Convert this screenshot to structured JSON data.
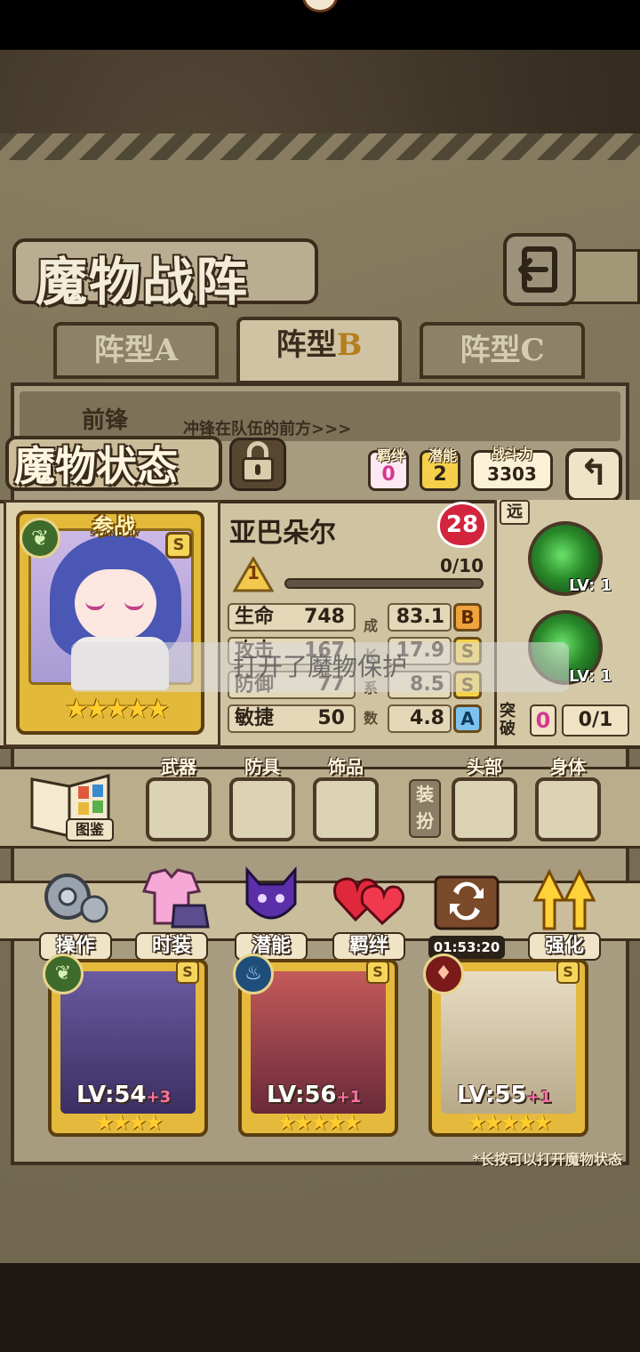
{
  "screen_title": "魔物战阵",
  "tabs": [
    {
      "prefix": "阵型",
      "suffix": "A",
      "active": false
    },
    {
      "prefix": "阵型",
      "suffix": "B",
      "active": true
    },
    {
      "prefix": "阵型",
      "suffix": "C",
      "active": false
    }
  ],
  "lane": {
    "label": "前锋",
    "desc": "冲锋在队伍的前方>>>"
  },
  "status": {
    "title": "魔物状态",
    "bond": {
      "label": "羁绊",
      "value": "0"
    },
    "potential": {
      "label": "潜能",
      "value": "2"
    },
    "power": {
      "label": "战斗力",
      "value": "3303"
    }
  },
  "monster": {
    "name": "亚巴朵尔",
    "level": "28",
    "rank": "1",
    "exp": "0/10",
    "exp_progress": 0,
    "standby": "参战",
    "standby_sub": "STAND BY",
    "grade_badge": "S",
    "star_count": 5,
    "stars": "★★★★★",
    "attrs": [
      {
        "name": "生命",
        "value": "748",
        "growth": "83.1",
        "grade": "B"
      },
      {
        "name": "攻击",
        "value": "167",
        "growth": "17.9",
        "grade": "S"
      },
      {
        "name": "防御",
        "value": "77",
        "growth": "8.5",
        "grade": "S"
      },
      {
        "name": "敏捷",
        "value": "50",
        "growth": "4.8",
        "grade": "A"
      }
    ],
    "growth_labels": [
      "成",
      "长",
      "系",
      "数"
    ]
  },
  "skills": {
    "range_tag": "远",
    "items": [
      {
        "lv": "LV: 1"
      },
      {
        "lv": "LV: 1"
      }
    ],
    "break_label": "突破",
    "break_value": "0",
    "break_progress": "0/1"
  },
  "toast": "打开了魔物保护",
  "equipment": {
    "book_label": "图鉴",
    "slots": [
      "武器",
      "防具",
      "饰品",
      "头部",
      "身体"
    ],
    "dressup": "装扮"
  },
  "actions": [
    {
      "label": "操作",
      "icon": "gear-icon"
    },
    {
      "label": "时装",
      "icon": "outfit-icon"
    },
    {
      "label": "潜能",
      "icon": "demon-icon"
    },
    {
      "label": "羁绊",
      "icon": "hearts-icon"
    },
    {
      "timer": "01:53:20",
      "icon": "swap-chest-icon"
    },
    {
      "label": "强化",
      "icon": "upgrade-arrows-icon"
    }
  ],
  "team": [
    {
      "lv": "LV:54",
      "plus": "+3",
      "element": "leaf",
      "stars": "★★★★",
      "rank": "S"
    },
    {
      "lv": "LV:56",
      "plus": "+1",
      "element": "water",
      "stars": "★★★★★",
      "rank": "S"
    },
    {
      "lv": "LV:55",
      "plus": "+1",
      "element": "fire",
      "stars": "★★★★★",
      "rank": "S"
    }
  ],
  "hint": "*长按可以打开魔物状态",
  "colors": {
    "accent_gold": "#e3b93a",
    "level_heart": "#d2253d",
    "grade_S": "#f3d24a",
    "grade_A": "#7ec3f0",
    "grade_B": "#f0a33c",
    "potential_chip": "#f6d04a",
    "bond_chip": "#f7a8d8"
  }
}
